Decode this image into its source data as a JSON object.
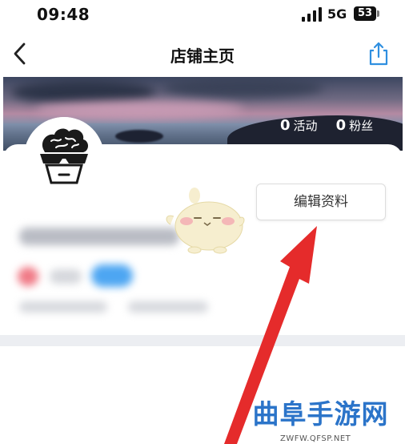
{
  "status_bar": {
    "time": "09:48",
    "network": "5G",
    "battery": "53"
  },
  "nav": {
    "title": "店铺主页"
  },
  "stats": {
    "activities_count": "0",
    "activities_label": "活动",
    "fans_count": "0",
    "fans_label": "粉丝"
  },
  "profile": {
    "edit_button_label": "编辑资料"
  },
  "watermark": {
    "main": "曲阜手游网",
    "sub": "ZWFW.QFSP.NET"
  },
  "colors": {
    "arrow": "#e52b2b",
    "watermark": "#2b74c9"
  }
}
